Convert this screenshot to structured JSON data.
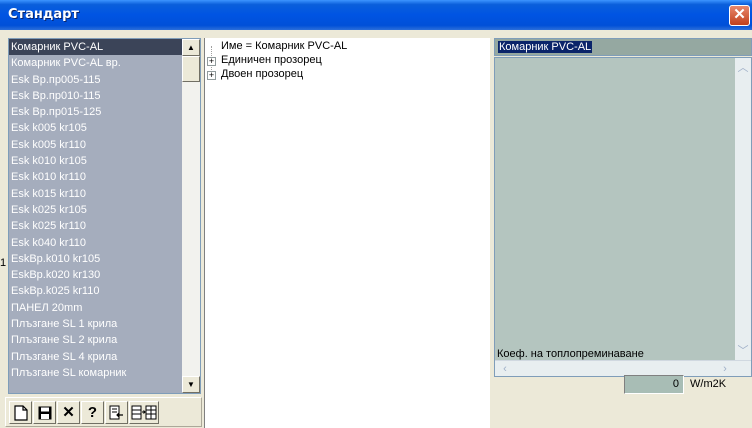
{
  "window": {
    "title": "Стандарт",
    "close_label": "✕"
  },
  "list": {
    "items": [
      "Комарник PVC-AL",
      "Комарник PVC-AL вр.",
      "Esk Вр.пр005-115",
      "Esk Вр.пр010-115",
      "Esk Вр.пр015-125",
      "Esk k005 kr105",
      "Esk k005 kr110",
      "Esk k010 kr105",
      "Esk k010 kr110",
      "Esk k015 kr110",
      "Esk k025 kr105",
      "Esk k025 kr110",
      "Esk k040 kr110",
      "EskВр.k010 kr105",
      "EskВр.k020 kr130",
      "EskВр.k025 kr110",
      "ПАНЕЛ 20mm",
      "Плъзгане SL 1 крила",
      "Плъзгане SL 2 крила",
      "Плъзгане SL 4 крила",
      "Плъзгане SL комарник"
    ],
    "selected_index": 0,
    "scroll_up_icon": "arrow-up-icon",
    "scroll_down_icon": "arrow-down-icon"
  },
  "toolbar": {
    "new_icon": "new-document-icon",
    "save_icon": "save-icon",
    "delete_label": "✕",
    "help_label": "?",
    "import_icon": "import-icon",
    "copy_icon": "copy-table-icon"
  },
  "tree": {
    "rows": [
      {
        "label": "Име  = Комарник PVC-AL",
        "expandable": false
      },
      {
        "label": "Единичен прозорец",
        "expandable": true
      },
      {
        "label": "Двоен прозорец",
        "expandable": true
      }
    ],
    "expander_symbol": "+"
  },
  "details": {
    "name_value": "Комарник PVC-AL",
    "coef_label": "Коеф. на топлопреминаване",
    "coef_value": "0",
    "coef_unit": "W/m2K",
    "stray_text": "1"
  },
  "colors": {
    "list_background": "#a5adbd",
    "list_selected": "#3b4458",
    "name_field_background": "#95a8a1",
    "notes_background": "#b4c5bf",
    "title_bar": "#0054e3"
  }
}
